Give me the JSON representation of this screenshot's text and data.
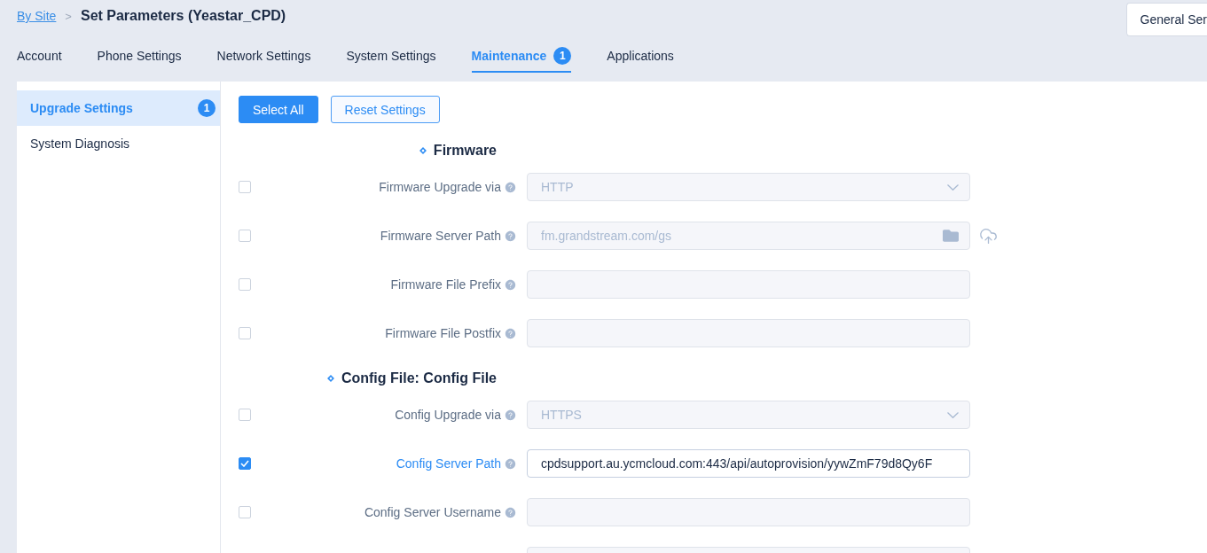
{
  "breadcrumb": {
    "link": "By Site",
    "separator": ">",
    "title": "Set Parameters (Yeastar_CPD)"
  },
  "header_button": {
    "label": "General Ser"
  },
  "tabs": [
    {
      "label": "Account",
      "selected": false
    },
    {
      "label": "Phone Settings",
      "selected": false
    },
    {
      "label": "Network Settings",
      "selected": false
    },
    {
      "label": "System Settings",
      "selected": false
    },
    {
      "label": "Maintenance",
      "selected": true,
      "badge": "1"
    },
    {
      "label": "Applications",
      "selected": false
    }
  ],
  "sidebar": {
    "items": [
      {
        "label": "Upgrade Settings",
        "selected": true,
        "badge": "1"
      },
      {
        "label": "System Diagnosis",
        "selected": false
      }
    ]
  },
  "toolbar": {
    "buttons": [
      {
        "label": "Select All",
        "kind": "primary"
      },
      {
        "label": "Reset Settings",
        "kind": "secondary"
      }
    ]
  },
  "sections": [
    {
      "title": "Firmware",
      "rows": [
        {
          "label": "Firmware Upgrade via",
          "checked": false,
          "kind": "select",
          "value": "HTTP"
        },
        {
          "label": "Firmware Server Path",
          "checked": false,
          "kind": "file",
          "value": "fm.grandstream.com/gs"
        },
        {
          "label": "Firmware File Prefix",
          "checked": false,
          "kind": "input"
        },
        {
          "label": "Firmware File Postfix",
          "checked": false,
          "kind": "input"
        }
      ]
    },
    {
      "title": "Config File: Config File",
      "rows": [
        {
          "label": "Config Upgrade via",
          "checked": false,
          "kind": "select",
          "value": "HTTPS"
        },
        {
          "label": "Config Server Path",
          "checked": true,
          "kind": "input",
          "value": "cpdsupport.au.ycmcloud.com:443/api/autoprovision/yywZmF79d8Qy6F"
        },
        {
          "label": "Config Server Username",
          "checked": false,
          "kind": "input"
        },
        {
          "kind": "input"
        }
      ]
    }
  ]
}
